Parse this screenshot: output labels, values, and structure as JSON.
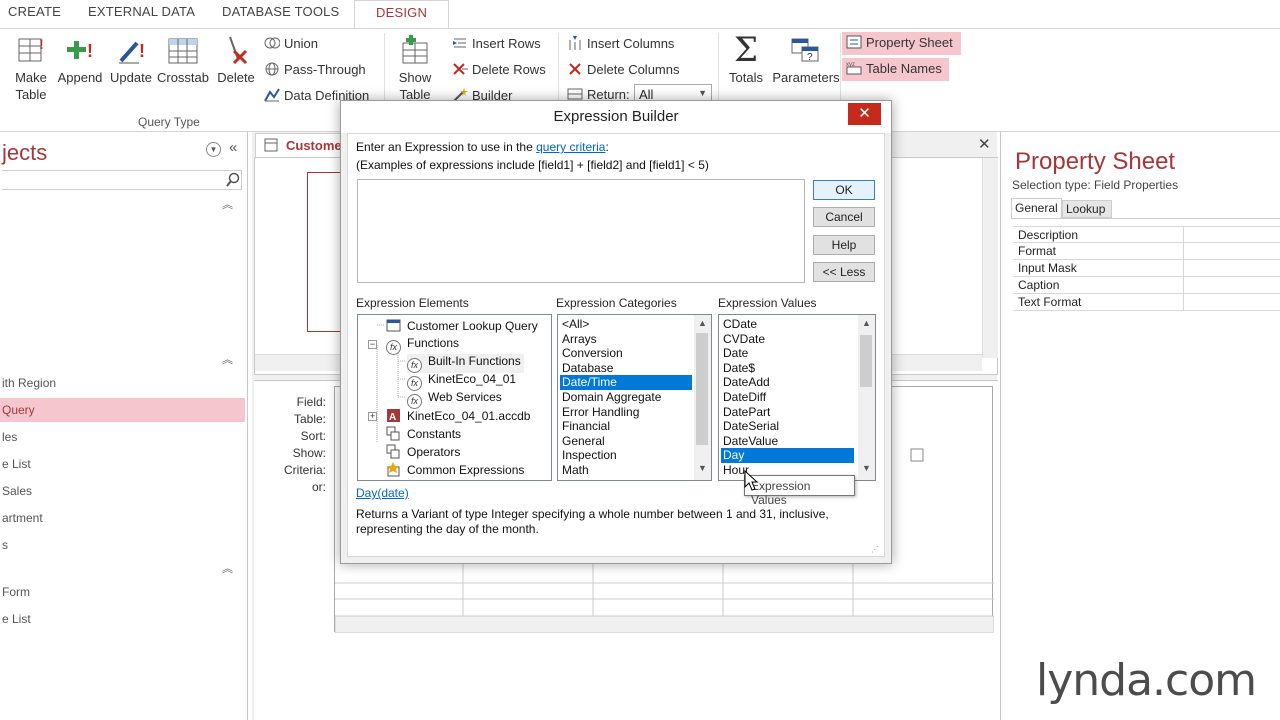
{
  "ribbon": {
    "tabs": [
      {
        "label": "CREATE"
      },
      {
        "label": "EXTERNAL DATA"
      },
      {
        "label": "DATABASE TOOLS"
      },
      {
        "label": "DESIGN"
      }
    ],
    "query_type": {
      "make_table_line1": "Make",
      "make_table_line2": "Table",
      "append": "Append",
      "update": "Update",
      "crosstab": "Crosstab",
      "delete": "Delete",
      "union": "Union",
      "pass_through": "Pass-Through",
      "data_definition": "Data Definition",
      "group_label": "Query Type"
    },
    "setup": {
      "show_table_line1": "Show",
      "show_table_line2": "Table",
      "insert_rows": "Insert Rows",
      "delete_rows": "Delete Rows",
      "builder": "Builder",
      "insert_columns": "Insert Columns",
      "delete_columns": "Delete Columns",
      "return_label": "Return:",
      "return_value": "All"
    },
    "show_hide": {
      "totals": "Totals",
      "parameters": "Parameters",
      "property_sheet": "Property Sheet",
      "table_names": "Table Names"
    }
  },
  "nav": {
    "title": "jects",
    "items": [
      {
        "label": "ith Region",
        "selected": false
      },
      {
        "label": "Query",
        "selected": true
      },
      {
        "label": "les",
        "selected": false
      },
      {
        "label": "e List",
        "selected": false
      },
      {
        "label": " Sales",
        "selected": false
      },
      {
        "label": "artment",
        "selected": false
      },
      {
        "label": "s",
        "selected": false
      },
      {
        "label": " Form",
        "selected": false
      },
      {
        "label": "e List",
        "selected": false
      }
    ]
  },
  "document": {
    "tab_label": "Custome",
    "grid_labels": [
      "Field:",
      "Table:",
      "Sort:",
      "Show:",
      "Criteria:",
      "or:"
    ]
  },
  "property_sheet": {
    "title": "Property Sheet",
    "selection_type": "Selection type:  Field Properties",
    "tabs": [
      "General",
      "Lookup"
    ],
    "rows": [
      "Description",
      "Format",
      "Input Mask",
      "Caption",
      "Text Format"
    ]
  },
  "dialog": {
    "title": "Expression Builder",
    "close": "✕",
    "instruction_prefix": "Enter an Expression to use in the ",
    "instruction_link": "query criteria",
    "instruction_suffix": ":",
    "examples": "(Examples of expressions include [field1] + [field2] and [field1] < 5)",
    "buttons": {
      "ok": "OK",
      "cancel": "Cancel",
      "help": "Help",
      "less": "<< Less"
    },
    "elements_label": "Expression Elements",
    "categories_label": "Expression Categories",
    "values_label": "Expression Values",
    "elements": [
      {
        "label": "Customer Lookup Query",
        "icon": "query-icon"
      },
      {
        "label": "Functions",
        "icon": "function-icon"
      },
      {
        "label": "Built-In Functions",
        "icon": "function-icon"
      },
      {
        "label": "KinetEco_04_01",
        "icon": "function-icon"
      },
      {
        "label": "Web Services",
        "icon": "function-icon"
      },
      {
        "label": "KinetEco_04_01.accdb",
        "icon": "access-db-icon"
      },
      {
        "label": "Constants",
        "icon": "constants-icon"
      },
      {
        "label": "Operators",
        "icon": "operators-icon"
      },
      {
        "label": "Common Expressions",
        "icon": "common-expressions-icon"
      }
    ],
    "categories": [
      "<All>",
      "Arrays",
      "Conversion",
      "Database",
      "Date/Time",
      "Domain Aggregate",
      "Error Handling",
      "Financial",
      "General",
      "Inspection",
      "Math"
    ],
    "selected_category": "Date/Time",
    "values": [
      "CDate",
      "CVDate",
      "Date",
      "Date$",
      "DateAdd",
      "DateDiff",
      "DatePart",
      "DateSerial",
      "DateValue",
      "Day",
      "Hour"
    ],
    "selected_value": "Day",
    "syntax": "Day(date)",
    "description": "Returns a Variant of type Integer specifying a whole number between 1 and 31, inclusive, representing the day of the month.",
    "tooltip": "Expression Values"
  },
  "watermark": "lynda.com",
  "colors": {
    "accent": "#a4373a",
    "selection": "#0078d7",
    "pink_highlight": "#f6c6cf",
    "close_red": "#c42b1c"
  }
}
